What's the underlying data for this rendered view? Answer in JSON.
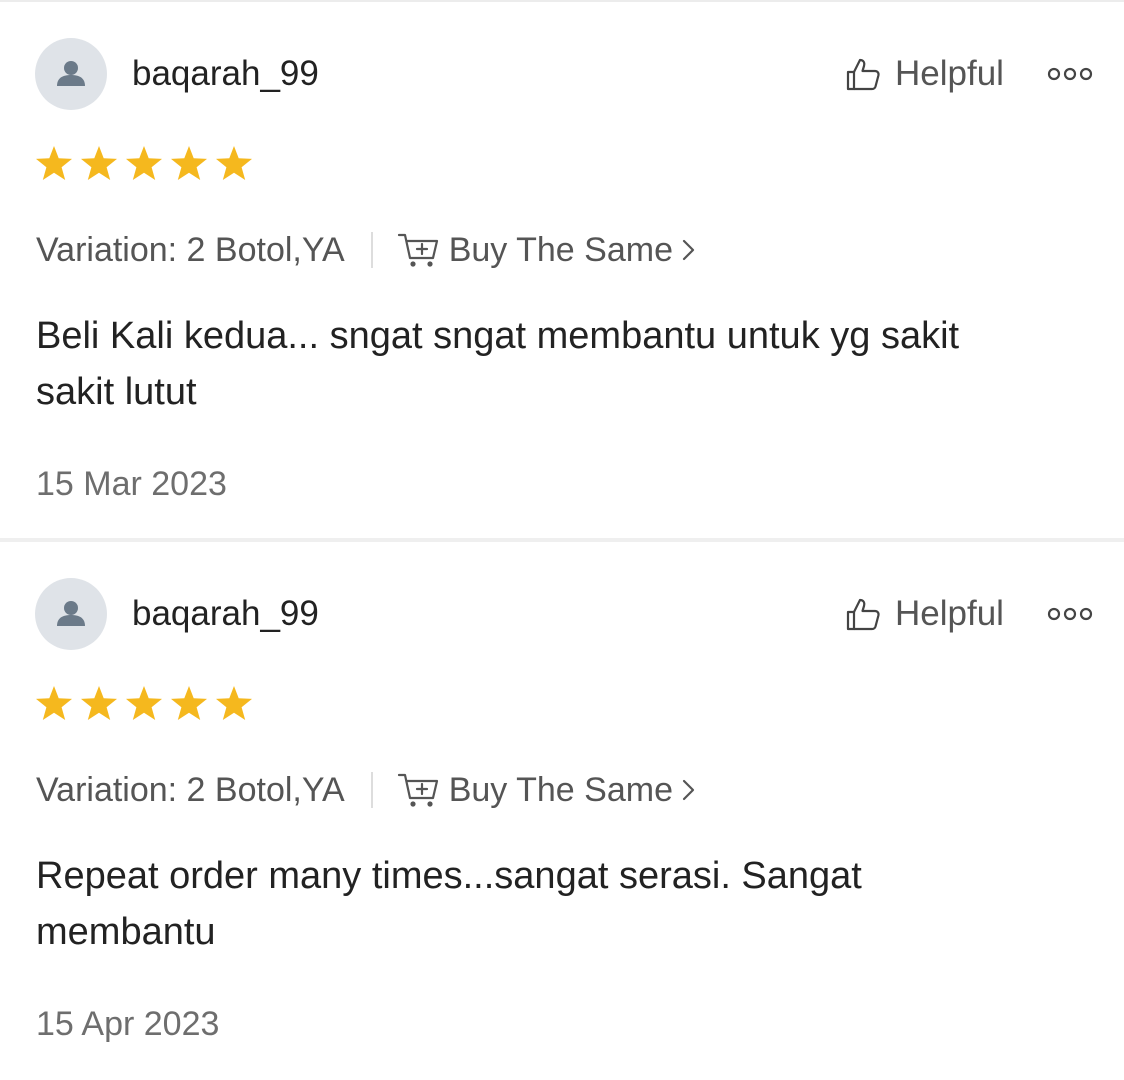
{
  "reviews": [
    {
      "username": "baqarah_99",
      "rating": 5,
      "helpful_label": "Helpful",
      "variation": "Variation: 2 Botol,YA",
      "buy_same_label": "Buy The Same",
      "comment": "Beli Kali kedua... sngat sngat membantu untuk yg sakit sakit lutut",
      "date": "15 Mar 2023"
    },
    {
      "username": "baqarah_99",
      "rating": 5,
      "helpful_label": "Helpful",
      "variation": "Variation: 2 Botol,YA",
      "buy_same_label": "Buy The Same",
      "comment": "Repeat order many times...sangat serasi. Sangat membantu",
      "date": "15 Apr 2023"
    }
  ],
  "colors": {
    "star": "#f5b81e",
    "text_primary": "#222222",
    "text_secondary": "#555555",
    "date": "#6e6e6e",
    "avatar_bg": "#dfe3e8",
    "avatar_fg": "#6b7a89"
  },
  "icons": {
    "avatar": "user-silhouette-icon",
    "helpful": "thumbs-up-icon",
    "more": "more-dots-icon",
    "star": "star-icon",
    "cart": "cart-add-icon",
    "chevron": "chevron-right-icon"
  }
}
